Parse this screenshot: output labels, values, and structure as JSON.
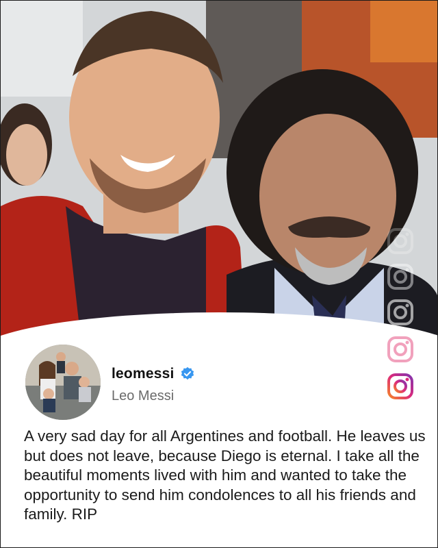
{
  "post": {
    "username": "leomessi",
    "display_name": "Leo Messi",
    "verified": true,
    "caption": "A very sad day for all Argentines and football. He leaves us but does not leave, because Diego is eternal. I take all the beautiful moments lived with him and wanted to take the opportunity to send him condolences to all his friends and family. RIP"
  },
  "icons": {
    "verified_badge": "verified-badge-icon",
    "instagram": "instagram-icon"
  },
  "colors": {
    "verified_blue": "#3897f0",
    "instagram_pink": "#e1306c"
  }
}
